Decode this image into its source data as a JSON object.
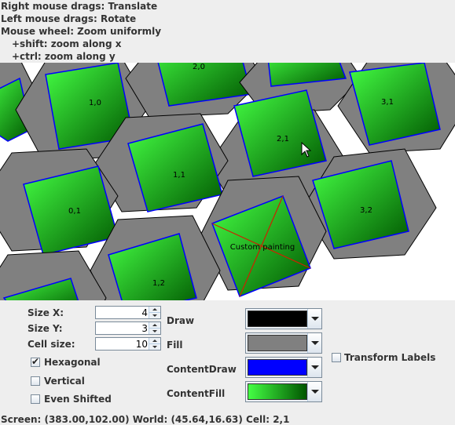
{
  "help": {
    "line1": "Right mouse drags: Translate",
    "line2": "Left mouse drags: Rotate",
    "line3": "Mouse wheel: Zoom uniformly",
    "line4": "+shift: zoom along x",
    "line5": "+ctrl: zoom along y"
  },
  "canvas": {
    "cell_labels": [
      "2,0",
      "1,0",
      "3,1",
      "2,1",
      "1,1",
      "0,1",
      "3,2",
      "1,2"
    ],
    "custom_label": "Custom painting",
    "colors": {
      "background": "#ffffff",
      "fill": "#808080",
      "draw": "#000000",
      "content_draw": "#0000ff",
      "content_fill_light": "#44ff44",
      "content_fill_dark": "#005500",
      "custom_cross": "#cc2200"
    }
  },
  "controls": {
    "size_x": {
      "label": "Size X:",
      "value": "4"
    },
    "size_y": {
      "label": "Size Y:",
      "value": "3"
    },
    "cell_size": {
      "label": "Cell size:",
      "value": "10"
    },
    "hexagonal": {
      "label": "Hexagonal",
      "checked": true
    },
    "vertical": {
      "label": "Vertical",
      "checked": false
    },
    "even_shifted": {
      "label": "Even Shifted",
      "checked": false
    },
    "draw": {
      "label": "Draw",
      "color": "#000000"
    },
    "fill": {
      "label": "Fill",
      "color": "#808080"
    },
    "content_draw": {
      "label": "ContentDraw",
      "color": "#0000ff"
    },
    "content_fill": {
      "label": "ContentFill",
      "color_light": "#44ff44",
      "color_dark": "#005500"
    },
    "transform_labels": {
      "label": "Transform Labels",
      "checked": false
    }
  },
  "status": "Screen: (383.00,102.00) World: (45.64,16.63) Cell: 2,1"
}
